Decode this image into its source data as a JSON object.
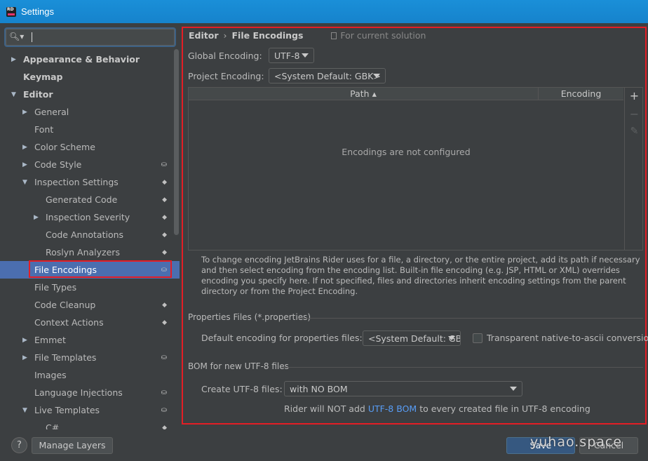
{
  "window": {
    "title": "Settings",
    "app_icon_text": "RD"
  },
  "search": {
    "icon": "search-icon",
    "value": ""
  },
  "tree": {
    "items": [
      {
        "label": "Appearance & Behavior",
        "bold": true,
        "level": 0,
        "arrow": "collapsed",
        "badge": ""
      },
      {
        "label": "Keymap",
        "bold": true,
        "level": 0,
        "arrow": "none",
        "badge": ""
      },
      {
        "label": "Editor",
        "bold": true,
        "level": 0,
        "arrow": "expanded",
        "badge": ""
      },
      {
        "label": "General",
        "bold": false,
        "level": 1,
        "arrow": "collapsed",
        "badge": ""
      },
      {
        "label": "Font",
        "bold": false,
        "level": 1,
        "arrow": "none",
        "badge": ""
      },
      {
        "label": "Color Scheme",
        "bold": false,
        "level": 1,
        "arrow": "collapsed",
        "badge": ""
      },
      {
        "label": "Code Style",
        "bold": false,
        "level": 1,
        "arrow": "collapsed",
        "badge": "project"
      },
      {
        "label": "Inspection Settings",
        "bold": false,
        "level": 1,
        "arrow": "expanded",
        "badge": "layers"
      },
      {
        "label": "Generated Code",
        "bold": false,
        "level": 2,
        "arrow": "none",
        "badge": "layers"
      },
      {
        "label": "Inspection Severity",
        "bold": false,
        "level": 2,
        "arrow": "collapsed",
        "badge": "layers"
      },
      {
        "label": "Code Annotations",
        "bold": false,
        "level": 2,
        "arrow": "none",
        "badge": "layers"
      },
      {
        "label": "Roslyn Analyzers",
        "bold": false,
        "level": 2,
        "arrow": "none",
        "badge": "layers"
      },
      {
        "label": "File Encodings",
        "bold": false,
        "level": 1,
        "arrow": "none",
        "badge": "project",
        "selected": true
      },
      {
        "label": "File Types",
        "bold": false,
        "level": 1,
        "arrow": "none",
        "badge": ""
      },
      {
        "label": "Code Cleanup",
        "bold": false,
        "level": 1,
        "arrow": "none",
        "badge": "layers"
      },
      {
        "label": "Context Actions",
        "bold": false,
        "level": 1,
        "arrow": "none",
        "badge": "layers"
      },
      {
        "label": "Emmet",
        "bold": false,
        "level": 1,
        "arrow": "collapsed",
        "badge": ""
      },
      {
        "label": "File Templates",
        "bold": false,
        "level": 1,
        "arrow": "collapsed",
        "badge": "project"
      },
      {
        "label": "Images",
        "bold": false,
        "level": 1,
        "arrow": "none",
        "badge": ""
      },
      {
        "label": "Language Injections",
        "bold": false,
        "level": 1,
        "arrow": "none",
        "badge": "project"
      },
      {
        "label": "Live Templates",
        "bold": false,
        "level": 1,
        "arrow": "expanded",
        "badge": "project"
      },
      {
        "label": "C#",
        "bold": false,
        "level": 2,
        "arrow": "none",
        "badge": "layers"
      }
    ]
  },
  "breadcrumb": {
    "parent": "Editor",
    "separator": "›",
    "current": "File Encodings",
    "scope": "For current solution"
  },
  "global_encoding": {
    "label": "Global Encoding:",
    "value": "UTF-8"
  },
  "project_encoding": {
    "label": "Project Encoding:",
    "value": "<System Default: GBK>"
  },
  "table": {
    "columns": [
      "Path ▴",
      "Encoding"
    ],
    "empty_text": "Encodings are not configured",
    "tools": {
      "add": "+",
      "remove": "−",
      "edit": "✎"
    }
  },
  "help_text": "To change encoding JetBrains Rider uses for a file, a directory, or the entire project, add its path if necessary and then select encoding from the encoding list. Built-in file encoding (e.g. JSP, HTML or XML) overrides encoding you specify here. If not specified, files and directories inherit encoding settings from the parent directory or from the Project Encoding.",
  "properties": {
    "section_title": "Properties Files (*.properties)",
    "default_label": "Default encoding for properties files:",
    "default_value": "<System Default: GBK>",
    "transparent_label": "Transparent native-to-ascii conversion",
    "transparent_checked": false
  },
  "bom": {
    "section_title": "BOM for new UTF-8 files",
    "create_label": "Create UTF-8 files:",
    "create_value": "with NO BOM",
    "note_prefix": "Rider will NOT add ",
    "note_link": "UTF-8 BOM",
    "note_suffix": " to every created file in UTF-8 encoding"
  },
  "footer": {
    "help": "?",
    "manage_layers": "Manage Layers",
    "save": "Save",
    "cancel": "Cancel",
    "watermark": "yuhao.space"
  },
  "colors": {
    "accent": "#4b6eaf",
    "title_bar": "#1a8fd8",
    "highlight_border": "#e31e25",
    "link": "#589df6"
  }
}
